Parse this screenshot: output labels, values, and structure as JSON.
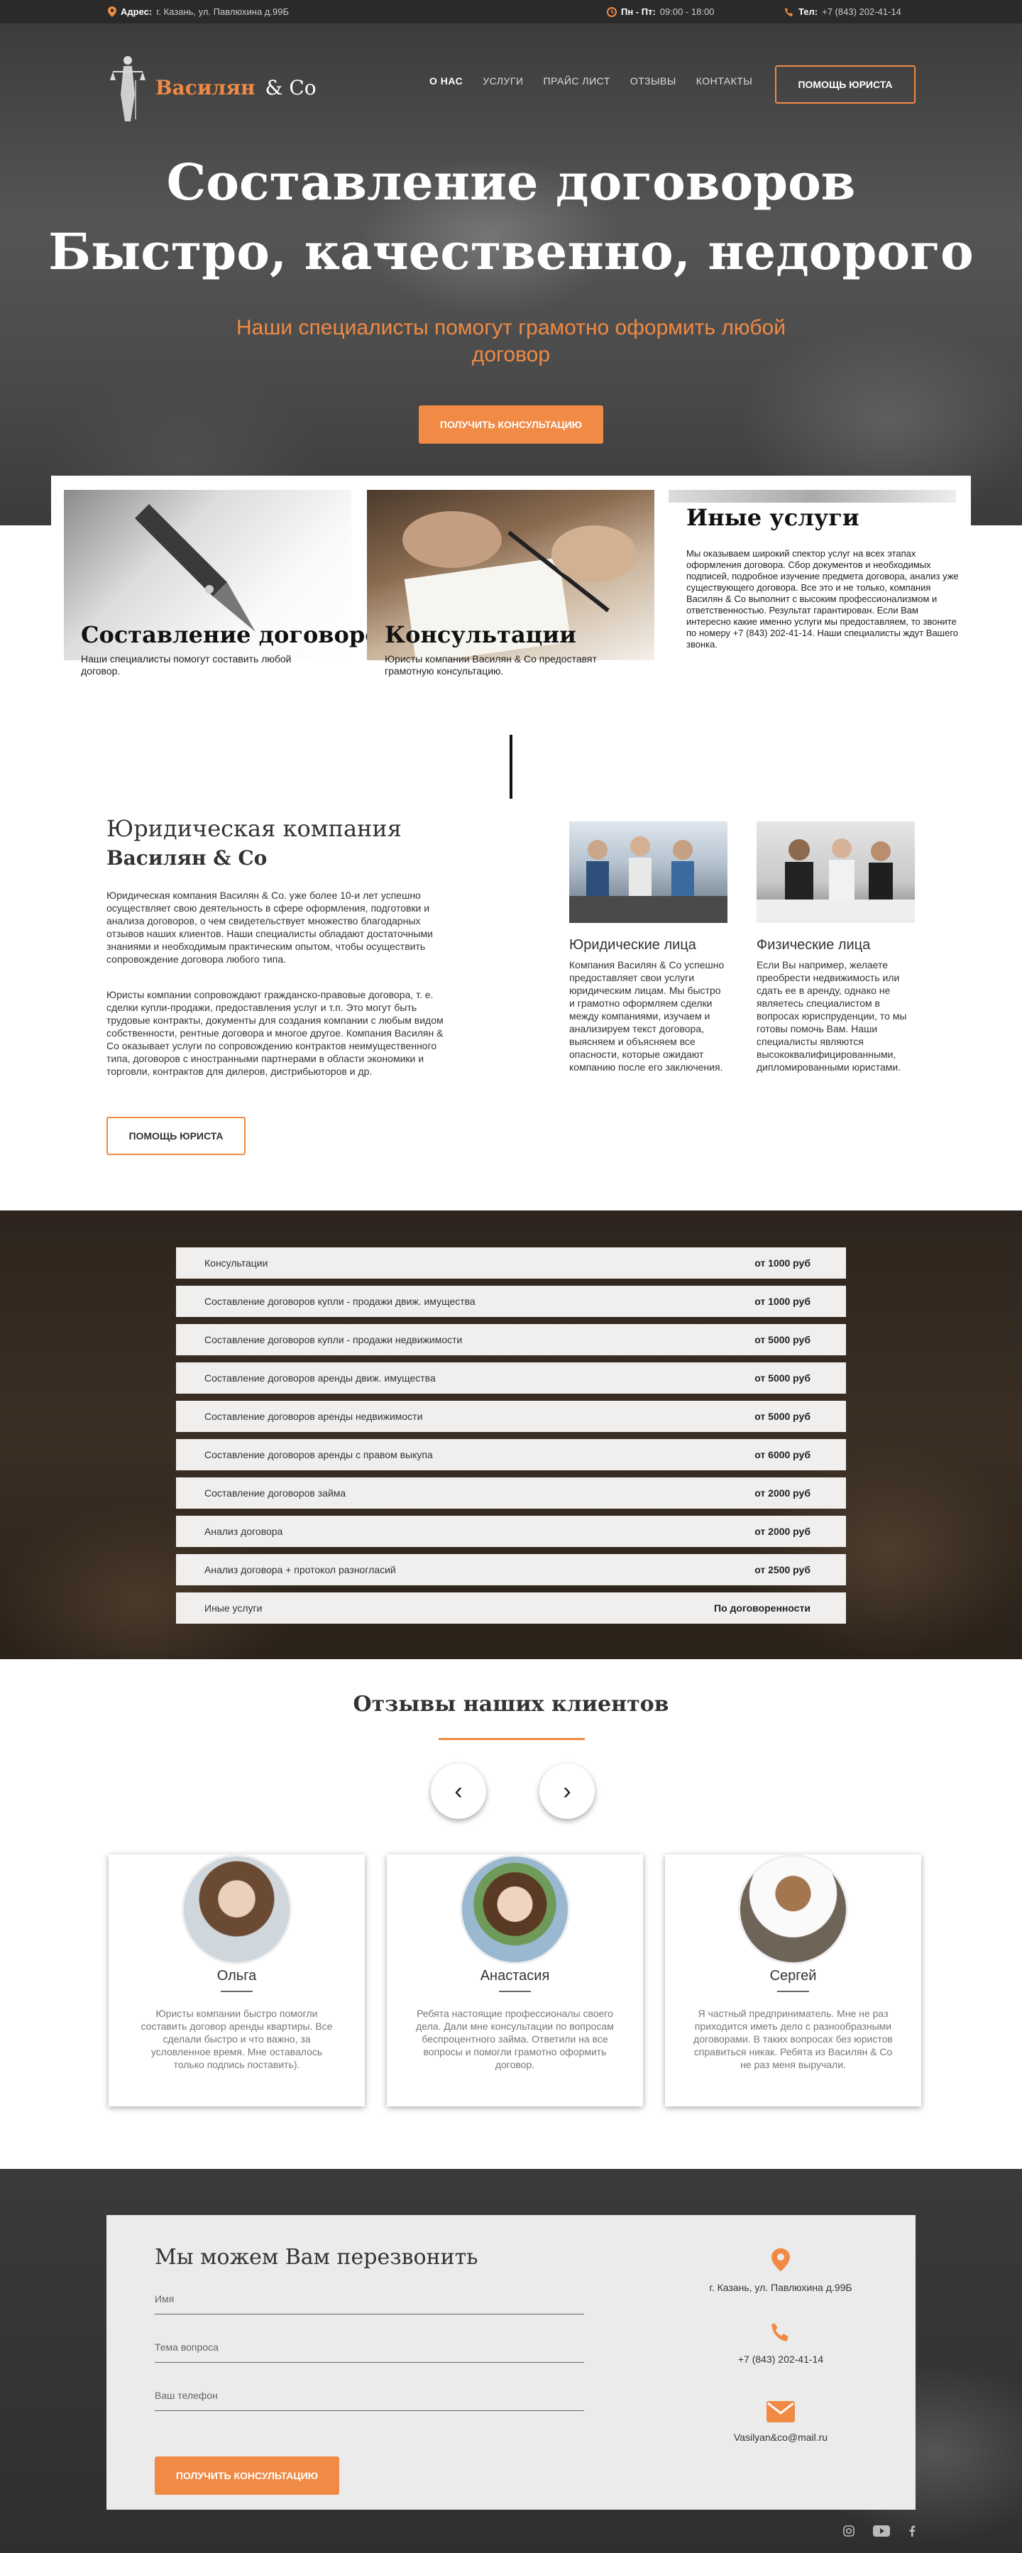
{
  "topbar": {
    "address_label": "Адрес:",
    "address": "г. Казань, ул. Павлюхина д.99Б",
    "hours_label": "Пн - Пт:",
    "hours": "09:00 - 18:00",
    "phone_label": "Тел:",
    "phone": "+7 (843) 202-41-14"
  },
  "logo": {
    "name": "Василян",
    "co": "& Co"
  },
  "nav": [
    "О НАС",
    "УСЛУГИ",
    "ПРАЙС ЛИСТ",
    "ОТЗЫВЫ",
    "КОНТАКТЫ"
  ],
  "header_button": "ПОМОЩЬ ЮРИСТА",
  "hero": {
    "title_line1": "Составление договоров",
    "title_line2": "Быстро, качественно, недорого",
    "subtitle": "Наши специалисты помогут грамотно оформить любой договор",
    "button": "ПОЛУЧИТЬ КОНСУЛЬТАЦИЮ"
  },
  "cards": [
    {
      "title": "Составление договоров",
      "text": "Наши специалисты помогут составить любой договор."
    },
    {
      "title": "Консультации",
      "text": "Юристы компании Василян & Co предоставят грамотную консультацию."
    },
    {
      "title": "Иные услуги",
      "text": "Мы оказываем широкий спектор услуг на всех этапах оформления договора. Сбор документов и необходимых подписей, подробное изучение предмета договора, анализ уже существующего договора. Все это и не только, компания Василян & Co выполнит с высоким профессионализмом и ответственностью. Результат гарантирован. Если Вам интересно какие именно услуги мы предоставляем, то звоните по номеру +7 (843) 202-41-14. Наши специалисты ждут Вашего звонка."
    }
  ],
  "about": {
    "heading1": "Юридическая компания",
    "heading2": "Василян & Co",
    "para1": "Юридическая компания Василян & Co. уже более 10-и лет успешно осуществляет свою деятельность в сфере оформления, подготовки и анализа договоров, о чем свидетельствует множество благодарных отзывов наших клиентов. Наши специалисты обладают достаточными знаниями и необходимым практическим опытом, чтобы осуществить сопровождение договора любого типа.",
    "para2": "Юристы компании сопровождают гражданско-правовые договора, т. е. сделки купли-продажи, предоставления услуг и т.п. Это могут быть трудовые контракты, документы для создания компании с любым видом собственности, рентные договора и многое другое. Компания Василян & Co оказывает услуги по сопровождению контрактов неимущественного типа, договоров с иностранными партнерами в области экономики и торговли, контрактов для дилеров, дистрибьюторов и др.",
    "button": "ПОМОЩЬ ЮРИСТА",
    "legal_title": "Юридические лица",
    "legal_text": "Компания Василян & Co успешно предоставляет свои услуги юридическим лицам. Мы быстро и грамотно оформляем сделки между компаниями, изучаем и анализируем текст договора, выясняем и объясняем все опасности, которые ожидают компанию после его заключения.",
    "phys_title": "Физические лица",
    "phys_text": "Если Вы например, желаете преобрести недвижимость или сдать ее в аренду, однако не являетесь специалистом в вопросах юриспруденции, то мы готовы помочь Вам. Наши специалисты являются высококвалифицированными, дипломированными юристами."
  },
  "prices": [
    {
      "name": "Консультации",
      "price": "от 1000 руб"
    },
    {
      "name": "Составление договоров купли - продажи движ. имущества",
      "price": "от 1000 руб"
    },
    {
      "name": "Составление договоров купли - продажи недвижимости",
      "price": "от 5000 руб"
    },
    {
      "name": "Составление договоров аренды движ. имущества",
      "price": "от 5000 руб"
    },
    {
      "name": "Составление договоров аренды недвижимости",
      "price": "от 5000 руб"
    },
    {
      "name": "Составление договоров аренды с правом выкупа",
      "price": "от 6000 руб"
    },
    {
      "name": "Составление договоров займа",
      "price": "от 2000 руб"
    },
    {
      "name": "Анализ договора",
      "price": "от 2000 руб"
    },
    {
      "name": "Анализ договора + протокол разногласий",
      "price": "от 2500 руб"
    },
    {
      "name": "Иные услуги",
      "price": "По договоренности"
    }
  ],
  "reviews": {
    "title": "Отзывы наших клиентов",
    "prev": "‹",
    "next": "›",
    "items": [
      {
        "name": "Ольга",
        "text": "Юристы компании быстро помогли составить договор аренды квартиры. Все сделали быстро и что важно, за условленное время. Мне оставалось только подпись поставить)."
      },
      {
        "name": "Анастасия",
        "text": "Ребята настоящие профессионалы своего дела. Дали мне консультации по вопросам беспроцентного займа. Ответили на все вопросы и помогли грамотно оформить договор."
      },
      {
        "name": "Сергей",
        "text": "Я частный предприниматель. Мне не раз приходится иметь дело с разнообразными договорами. В таких вопросах без юристов справиться никак. Ребята из Василян & Co не раз меня выручали."
      }
    ]
  },
  "callback": {
    "title": "Мы можем Вам перезвонить",
    "name_placeholder": "Имя",
    "topic_placeholder": "Тема вопроса",
    "phone_placeholder": "Ваш  телефон",
    "button": "ПОЛУЧИТЬ КОНСУЛЬТАЦИЮ",
    "address": "г. Казань, ул. Павлюхина д.99Б",
    "phone": "+7 (843) 202-41-14",
    "email": "Vasilyan&co@mail.ru"
  },
  "colors": {
    "accent": "#f08a44",
    "dark": "#2a2a2a"
  }
}
